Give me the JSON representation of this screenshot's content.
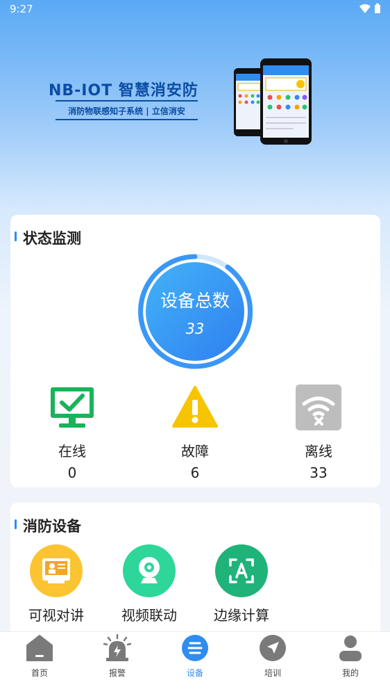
{
  "status_bar": {
    "time": "9:27"
  },
  "banner": {
    "title": "NB-IOT 智慧消安防",
    "subtitle": "消防物联感知子系统 | 立信消安"
  },
  "status_section": {
    "title": "状态监测",
    "gauge_label": "设备总数",
    "gauge_value": "33",
    "stats": [
      {
        "label": "在线",
        "value": "0",
        "icon": "monitor-check-icon",
        "color": "#19b35a"
      },
      {
        "label": "故障",
        "value": "6",
        "icon": "warning-icon",
        "color": "#f7c500"
      },
      {
        "label": "离线",
        "value": "33",
        "icon": "wifi-off-icon",
        "color": "#bdbdbd"
      }
    ]
  },
  "devices_section": {
    "title": "消防设备",
    "items": [
      {
        "label": "可视对讲",
        "icon": "video-intercom-icon",
        "color": "#fbc430"
      },
      {
        "label": "视频联动",
        "icon": "webcam-icon",
        "color": "#2ed69a"
      },
      {
        "label": "边缘计算",
        "icon": "edge-compute-icon",
        "color": "#1fb37a"
      }
    ]
  },
  "tabbar": {
    "tabs": [
      {
        "label": "首页",
        "icon": "home-icon"
      },
      {
        "label": "报警",
        "icon": "alarm-icon"
      },
      {
        "label": "设备",
        "icon": "device-icon",
        "active": true
      },
      {
        "label": "培训",
        "icon": "navigation-icon"
      },
      {
        "label": "我的",
        "icon": "user-icon"
      }
    ],
    "active_color": "#2f8cf0",
    "inactive_color": "#7a7a7a"
  }
}
